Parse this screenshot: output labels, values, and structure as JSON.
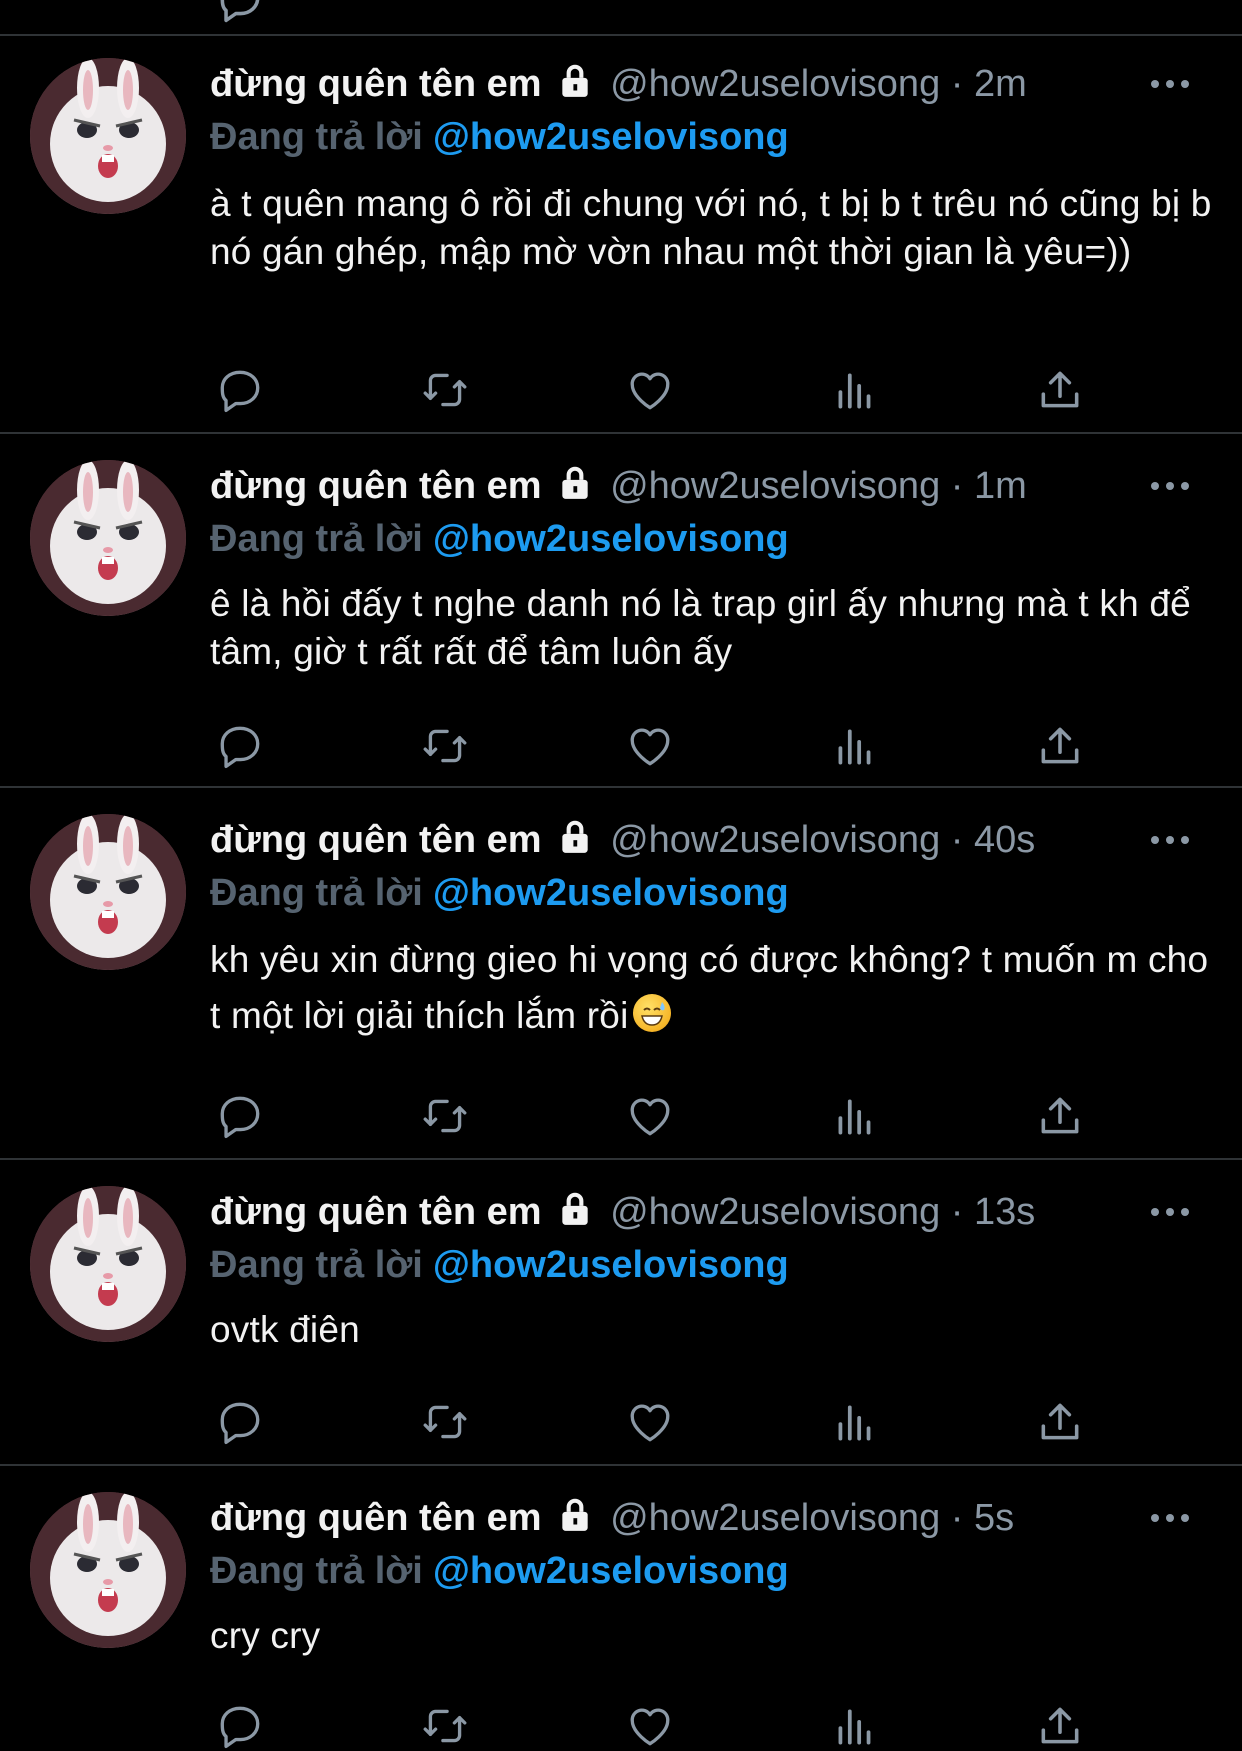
{
  "tweets": [
    {
      "name": "đừng quên tên em",
      "handle": "@how2uselovisong",
      "separator": "·",
      "time": "2m",
      "reply_label": "Đang trả lời",
      "reply_to": "@how2uselovisong",
      "text": "à t quên mang ô rồi đi chung với nó, t bị b t trêu nó cũng bị b nó gán ghép, mập mờ vờn nhau một thời gian là yêu=))"
    },
    {
      "name": "đừng quên tên em",
      "handle": "@how2uselovisong",
      "separator": "·",
      "time": "1m",
      "reply_label": "Đang trả lời",
      "reply_to": "@how2uselovisong",
      "text": "ê là hồi đấy t nghe danh nó là trap girl ấy nhưng mà t kh để tâm, giờ t rất rất để tâm luôn ấy"
    },
    {
      "name": "đừng quên tên em",
      "handle": "@how2uselovisong",
      "separator": "·",
      "time": "40s",
      "reply_label": "Đang trả lời",
      "reply_to": "@how2uselovisong",
      "text": "kh yêu xin đừng gieo hi vọng có được không? t muốn m cho t một lời giải thích lắm rồi",
      "emoji": "grinning-sweat-emoji"
    },
    {
      "name": "đừng quên tên em",
      "handle": "@how2uselovisong",
      "separator": "·",
      "time": "13s",
      "reply_label": "Đang trả lời",
      "reply_to": "@how2uselovisong",
      "text": "ovtk điên"
    },
    {
      "name": "đừng quên tên em",
      "handle": "@how2uselovisong",
      "separator": "·",
      "time": "5s",
      "reply_label": "Đang trả lời",
      "reply_to": "@how2uselovisong",
      "text": "cry cry"
    }
  ],
  "action_icons": [
    "reply-icon",
    "retweet-icon",
    "like-icon",
    "views-icon",
    "share-icon"
  ],
  "colors": {
    "background": "#000000",
    "text": "#e7e9ea",
    "muted": "#8b98a5",
    "accent": "#1d9bf0",
    "divider": "#2f3336"
  }
}
